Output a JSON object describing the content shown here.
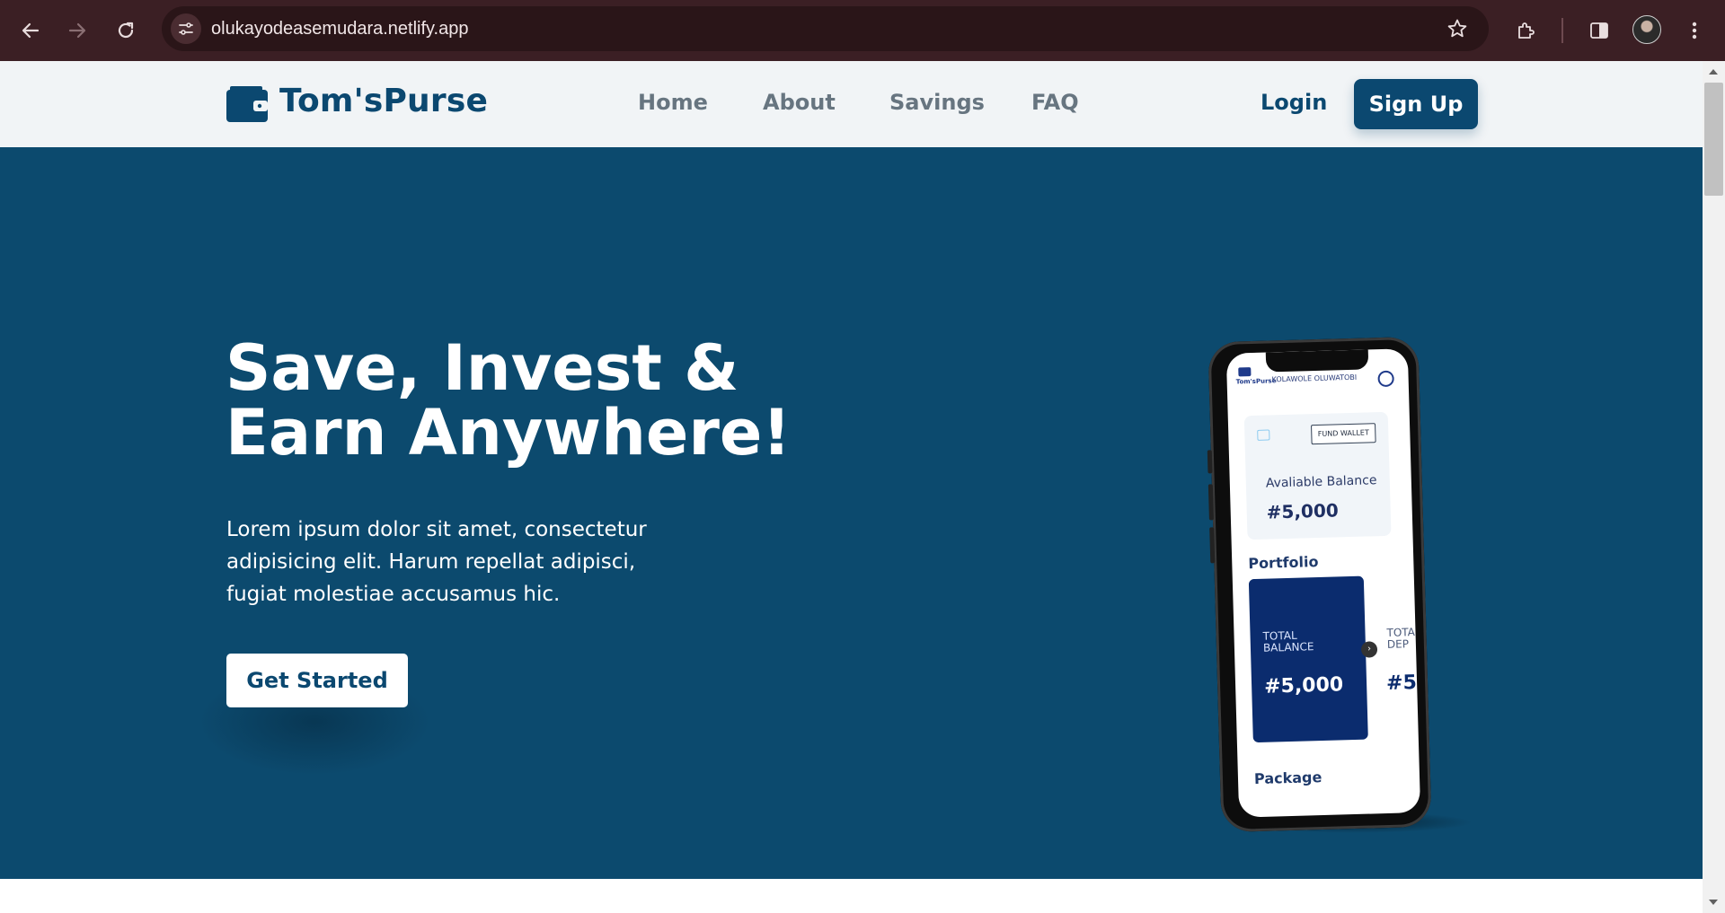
{
  "browser": {
    "url": "olukayodeasemudara.netlify.app"
  },
  "site": {
    "brand": "Tom'sPurse",
    "nav": [
      {
        "label": "Home"
      },
      {
        "label": "About"
      },
      {
        "label": "Savings"
      },
      {
        "label": "FAQ"
      }
    ],
    "login_label": "Login",
    "signup_label": "Sign Up",
    "colors": {
      "primary": "#0b4870",
      "hero_bg": "#0c4a6e",
      "header_bg": "#f1f4f6",
      "nav_text": "#677580"
    }
  },
  "hero": {
    "title_line1": "Save, Invest &",
    "title_line2": "Earn Anywhere!",
    "description": "Lorem ipsum dolor sit amet, consectetur adipisicing elit. Harum repellat adipisci, fugiat molestiae accusamus hic.",
    "cta_label": "Get Started"
  },
  "phone_app": {
    "logo_text": "Tom'sPurse",
    "user_name": "KOLAWOLE OLUWATOBI",
    "fund_wallet_label": "FUND WALLET",
    "balance_label": "Avaliable Balance",
    "balance_value": "#5,000",
    "portfolio_title": "Portfolio",
    "total_balance_label": "TOTAL BALANCE",
    "total_balance_value": "#5,000",
    "peek_label": "TOTA DEP",
    "peek_value": "#5",
    "package_title": "Package"
  }
}
